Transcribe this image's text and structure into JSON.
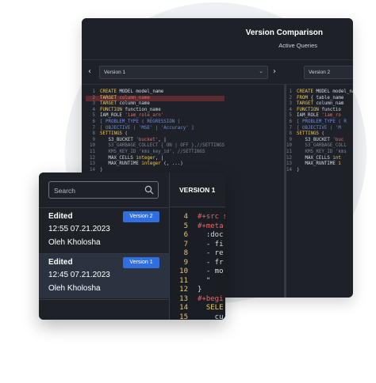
{
  "comparison": {
    "title": "Version Comparison",
    "subtitle": "Active Queries",
    "left_select": "Version 1",
    "right_select": "Version 2",
    "prev_arrow": "‹",
    "next_arrow": "›",
    "left_code": [
      {
        "n": "1",
        "html": "<span class='kw'>CREATE</span> MODEL model_name"
      },
      {
        "n": "2",
        "html": "<span class='kw'>TARGET</span> <span class='str'>column_name</span>",
        "hl": "red"
      },
      {
        "n": "3",
        "html": "<span class='kw'>TARGET</span> column_name"
      },
      {
        "n": "4",
        "html": "<span class='kw'>FUNCTION</span> function_name"
      },
      {
        "n": "5",
        "html": "IAM_ROLE <span class='str'>'iam_role_arn'</span>"
      },
      {
        "n": "6",
        "html": "<span class='par'>[ PROBLEM_TYPE ( REGRESSION )</span>"
      },
      {
        "n": "7",
        "html": "<span class='par'>[ OBJECTIVE ( 'MSE' | 'Accuracy' ]</span>"
      },
      {
        "n": "8",
        "html": "<span class='kw'>SETTINGS</span> ("
      },
      {
        "n": "9",
        "html": "   S3_BUCKET <span class='str'>'bucket'</span>, |"
      },
      {
        "n": "10",
        "html": "   <span class='cm'>S3_GARBAGE_COLLECT { ON | OFF },//SETTINGS</span>"
      },
      {
        "n": "11",
        "html": "   <span class='cm'>KMS_KEY_ID 'kms_key_id', //SETTINGS</span>"
      },
      {
        "n": "12",
        "html": "   MAX_CELLS <span class='kw'>integer</span>, |"
      },
      {
        "n": "13",
        "html": "   MAX_RUNTIME <span class='kw'>integer</span> (, ...)"
      },
      {
        "n": "14",
        "html": ")"
      }
    ],
    "right_code": [
      {
        "n": "1",
        "html": "<span class='kw'>CREATE</span> MODEL model_name"
      },
      {
        "n": "2",
        "html": "<span class='kw'>FROM</span> { table_name"
      },
      {
        "n": "3",
        "html": "<span class='kw'>TARGET</span> column_nam"
      },
      {
        "n": "4",
        "html": "<span class='kw'>FUNCTION</span> functio"
      },
      {
        "n": "5",
        "html": "IAM_ROLE <span class='str'>'iam_ro</span>"
      },
      {
        "n": "6",
        "html": "<span class='par'>[ PROBLEM_TYPE ( R</span>"
      },
      {
        "n": "7",
        "html": "<span class='par'>[ OBJECTIVE ( 'M</span>"
      },
      {
        "n": "8",
        "html": "<span class='kw'>SETTINGS</span> ("
      },
      {
        "n": "9",
        "html": "   S3_BUCKET <span class='str'>'buc</span>"
      },
      {
        "n": "10",
        "html": "   <span class='cm'>S3_GARBAGE_COLL</span>"
      },
      {
        "n": "11",
        "html": "   <span class='cm'>KMS_KEY_ID 'kms</span>"
      },
      {
        "n": "12",
        "html": "   MAX_CELLS <span class='kw'>int</span>"
      },
      {
        "n": "13",
        "html": "   MAX_RUNTIME <span class='kw'>i</span>"
      },
      {
        "n": "14",
        "html": ")"
      }
    ]
  },
  "history": {
    "search_placeholder": "Search",
    "items": [
      {
        "status": "Edited",
        "badge": "Version 2",
        "date": "12:55 07.21.2023",
        "author": "Oleh Kholosha"
      },
      {
        "status": "Edited",
        "badge": "Version 1",
        "date": "12:45 07.21.2023",
        "author": "Oleh Kholosha"
      }
    ],
    "code_title": "VERSION 1",
    "code_lines": [
      {
        "n": "4",
        "html": "<span style='color:#e36a6a'>#+src s</span>"
      },
      {
        "n": "5",
        "html": "<span style='color:#e36a6a'>#+meta</span>"
      },
      {
        "n": "6",
        "html": "<span class='pl'>  :doc</span>"
      },
      {
        "n": "7",
        "html": "<span class='pl'>  - fi</span>"
      },
      {
        "n": "8",
        "html": "<span class='pl'>  - re</span>"
      },
      {
        "n": "9",
        "html": "<span class='pl'>  - fr</span>"
      },
      {
        "n": "10",
        "html": "<span class='pl'>  - mo</span>"
      },
      {
        "n": "11",
        "html": "<span class='pl'>  \"</span>"
      },
      {
        "n": "12",
        "html": "<span class='pl'>}</span>"
      },
      {
        "n": "13",
        "html": "<span style='color:#e36a6a'>#+begi</span>"
      },
      {
        "n": "14",
        "html": "<span class='kw'>  SELE</span>"
      },
      {
        "n": "15",
        "html": "<span class='pl'>    cu</span>"
      }
    ]
  }
}
